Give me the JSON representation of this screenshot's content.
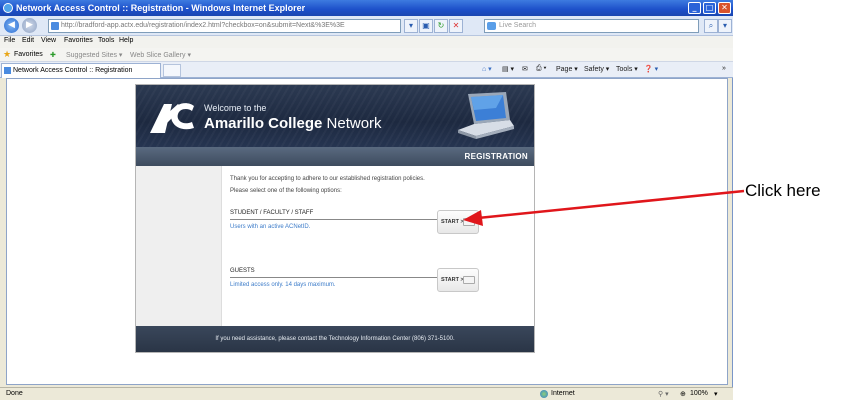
{
  "window": {
    "title": "Network Access Control :: Registration - Windows Internet Explorer",
    "minimize": "_",
    "maximize": "□",
    "close": "✕"
  },
  "address_bar": {
    "url": "http://bradford-app.actx.edu/registration/index2.html?checkbox=on&submit=Next&%3E%3E",
    "search_placeholder": "Live Search"
  },
  "menu": [
    "File",
    "Edit",
    "View",
    "Favorites",
    "Tools",
    "Help"
  ],
  "favorites": {
    "label": "Favorites",
    "suggested": "Suggested Sites ▾",
    "slice": "Web Slice Gallery ▾"
  },
  "tab": {
    "label": "Network Access Control :: Registration"
  },
  "command_bar": [
    "Page ▾",
    "Safety ▾",
    "Tools ▾"
  ],
  "banner": {
    "welcome": "Welcome to the",
    "college_bold": "Amarillo College",
    "college_rest": " Network"
  },
  "section_title": "REGISTRATION",
  "intro": [
    "Thank you for accepting to adhere to our established registration policies.",
    "Please select one of the following options:"
  ],
  "options": [
    {
      "title": "STUDENT / FACULTY / STAFF",
      "desc": "Users with an active ACNetID.",
      "button": "START >>"
    },
    {
      "title": "GUESTS",
      "desc": "Limited access only. 14 days maximum.",
      "button": "START >>"
    }
  ],
  "footer": "If you need assistance, please contact the Technology Information Center (806) 371-5100.",
  "status": {
    "left": "Done",
    "zone": "Internet",
    "zoom": "100%"
  },
  "annotation": {
    "text": "Click here",
    "color": "#e0161b"
  }
}
